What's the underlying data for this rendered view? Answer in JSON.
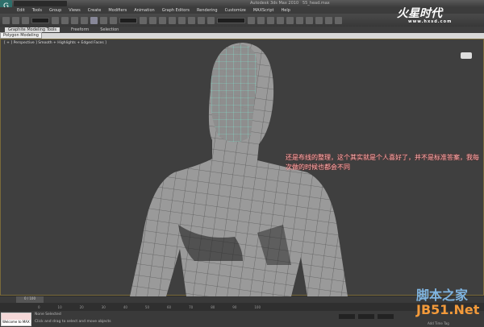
{
  "window": {
    "title": "Autodesk 3ds Max 2010",
    "file": "55_head.max"
  },
  "menu": [
    "Edit",
    "Tools",
    "Group",
    "Views",
    "Create",
    "Modifiers",
    "Animation",
    "Graph Editors",
    "Rendering",
    "Customize",
    "MAXScript",
    "Help"
  ],
  "ribbon": {
    "tabs": [
      "Graphite Modeling Tools",
      "Freeform",
      "Selection"
    ],
    "panel": "Polygon Modeling"
  },
  "viewport": {
    "label": "[ + ] Perspective ] Smooth + Highlights + Edged Faces ]"
  },
  "annotation": "还是布线的整理，这个其实就是个人喜好了，并不是标准答案，我每次做的时候也都会不同",
  "logo": {
    "name": "火星时代",
    "url": "www.hxsd.com"
  },
  "timeline": {
    "slider": "0 / 100",
    "ticks": [
      "0",
      "10",
      "20",
      "30",
      "40",
      "50",
      "60",
      "70",
      "80",
      "90",
      "100"
    ]
  },
  "status": {
    "welcome": "Welcome to MAX",
    "selection": "None Selected",
    "prompt": "Click and drag to select and move objects",
    "add_time_tag": "Add Time Tag"
  },
  "watermark": {
    "line1": "脚本之家",
    "line2": "JB51.Net"
  }
}
